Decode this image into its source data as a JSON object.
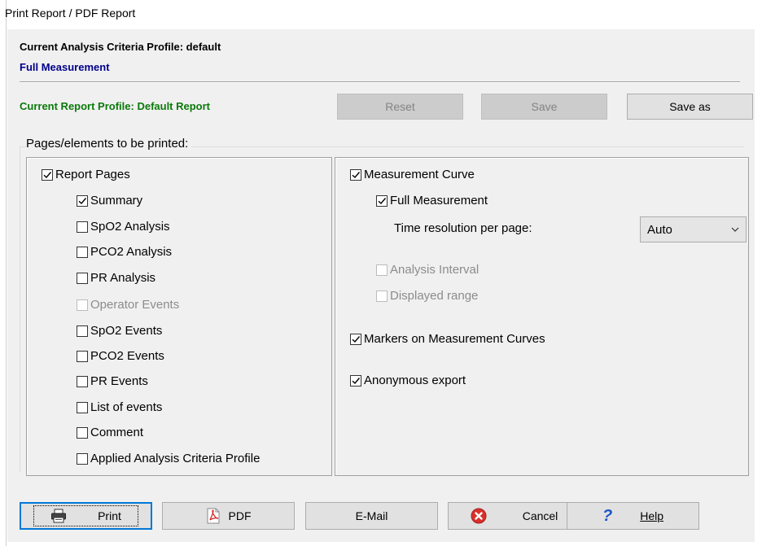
{
  "window": {
    "title": "Print Report / PDF Report"
  },
  "header": {
    "analysis_profile": "Current Analysis Criteria Profile: default",
    "measurement": "Full Measurement",
    "report_profile": "Current Report Profile:  Default Report"
  },
  "profile_buttons": {
    "reset": "Reset",
    "save": "Save",
    "save_as": "Save as"
  },
  "pages_group": {
    "label": "Pages/elements to be printed:"
  },
  "left_panel": {
    "report_pages": {
      "label": "Report Pages",
      "checked": true
    },
    "items": [
      {
        "label": "Summary",
        "checked": true,
        "enabled": true
      },
      {
        "label": "SpO2 Analysis",
        "checked": false,
        "enabled": true
      },
      {
        "label": "PCO2 Analysis",
        "checked": false,
        "enabled": true
      },
      {
        "label": "PR Analysis",
        "checked": false,
        "enabled": true
      },
      {
        "label": "Operator Events",
        "checked": false,
        "enabled": false
      },
      {
        "label": "SpO2 Events",
        "checked": false,
        "enabled": true
      },
      {
        "label": "PCO2 Events",
        "checked": false,
        "enabled": true
      },
      {
        "label": "PR Events",
        "checked": false,
        "enabled": true
      },
      {
        "label": "List of events",
        "checked": false,
        "enabled": true
      },
      {
        "label": "Comment",
        "checked": false,
        "enabled": true
      },
      {
        "label": "Applied Analysis Criteria Profile",
        "checked": false,
        "enabled": true
      }
    ]
  },
  "right_panel": {
    "measurement_curve": {
      "label": "Measurement Curve",
      "checked": true
    },
    "full_measurement": {
      "label": "Full Measurement",
      "checked": true
    },
    "time_resolution_label": "Time resolution per page:",
    "time_resolution_value": "Auto",
    "analysis_interval": {
      "label": "Analysis Interval",
      "checked": false,
      "enabled": false
    },
    "displayed_range": {
      "label": "Displayed range",
      "checked": false,
      "enabled": false
    },
    "markers": {
      "label": "Markers on Measurement Curves",
      "checked": true
    },
    "anonymous": {
      "label": "Anonymous export",
      "checked": true
    }
  },
  "footer": {
    "print": "Print",
    "pdf": "PDF",
    "email": "E-Mail",
    "cancel": "Cancel",
    "help": "Help"
  },
  "colors": {
    "measurement_text": "#00008b",
    "report_profile_text": "#0a7a0a",
    "cancel_icon": "#d9302c",
    "help_icon": "#1a56c9",
    "pdf_icon": "#d42a2a"
  }
}
